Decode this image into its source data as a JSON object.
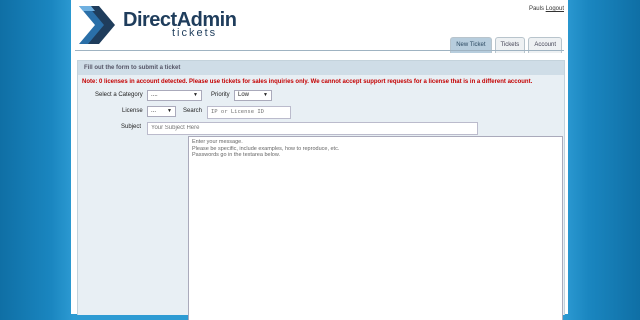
{
  "brand": {
    "name": "DirectAdmin",
    "sub": "tickets",
    "logo_icon": "directadmin-logo-icon"
  },
  "user": {
    "name": "Pauls",
    "logout_label": "Logout"
  },
  "tabs": [
    {
      "label": "New Ticket",
      "active": true
    },
    {
      "label": "Tickets",
      "active": false
    },
    {
      "label": "Account",
      "active": false
    }
  ],
  "form": {
    "title": "Fill out the form to submit a ticket",
    "note": "Note: 0 licenses in account detected. Please use tickets for sales inquiries only. We cannot accept support requests for a license that is in a different account.",
    "category_label": "Select a Category",
    "category_value": "....",
    "priority_label": "Priority",
    "priority_value": "Low",
    "license_label": "License",
    "license_value": "...",
    "search_label": "Search",
    "search_placeholder": "IP or License ID",
    "subject_label": "Subject",
    "subject_placeholder": "Your Subject Here",
    "message_lines": [
      "Enter your message.",
      "Please be specific, include examples, how to reproduce, etc.",
      "Passwords go in the textarea below."
    ]
  },
  "colors": {
    "note": "#c40000",
    "header_text": "#1f3d5c",
    "active_tab": "#b7cddd"
  }
}
